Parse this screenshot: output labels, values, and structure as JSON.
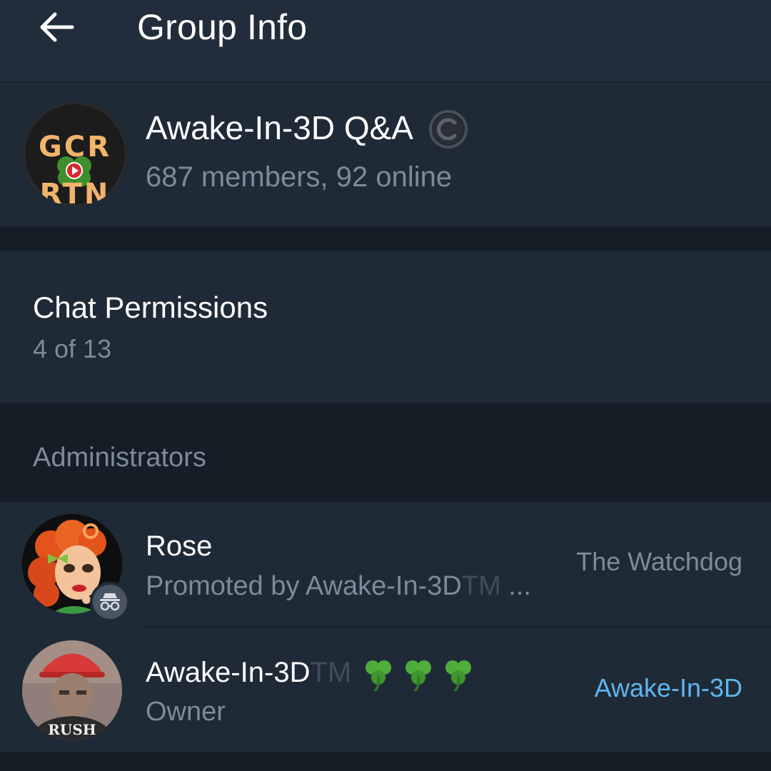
{
  "header": {
    "title": "Group Info",
    "back_icon": "arrow-left-icon"
  },
  "group": {
    "avatar_line1": "GCR",
    "avatar_line2": "RTN",
    "name": "Awake-In-3D Q&A",
    "badge_icon": "copyright-icon",
    "members": "687 members, 92 online"
  },
  "permissions": {
    "title": "Chat Permissions",
    "count": "4 of 13"
  },
  "administrators": {
    "header": "Administrators",
    "items": [
      {
        "name": "Rose",
        "subtitle_prefix": "Promoted by Awake-In-3D",
        "subtitle_tm": "TM",
        "subtitle_ellipsis": " ...",
        "role": "The Watchdog",
        "badge_icon": "incognito-icon"
      },
      {
        "name": "Awake-In-3D",
        "name_tm": "TM",
        "name_emoji_icon": "shamrock-icon",
        "subtitle": "Owner",
        "role": "Awake-In-3D"
      }
    ]
  },
  "colors": {
    "background": "#151e27",
    "card": "#1f2a37",
    "header": "#212d3b",
    "secondary_text": "#7d8b99",
    "link": "#5fb6ec",
    "avatar_text": "#f2b36b"
  }
}
